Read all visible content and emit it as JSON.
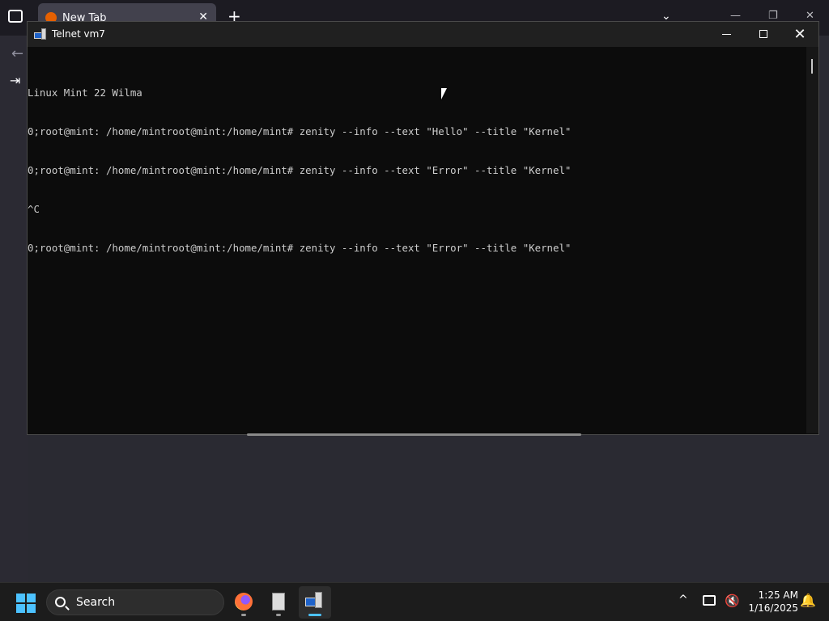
{
  "browser": {
    "tab_label": "New Tab",
    "tab_close_glyph": "✕",
    "new_tab_glyph": "+",
    "list_tabs_glyph": "⌄",
    "minimize_glyph": "—",
    "restore_glyph": "❐",
    "close_glyph": "✕",
    "back_glyph": "←",
    "signin_glyph": "⇥",
    "icons": [
      "tab-list-icon",
      "firefox-favicon",
      "back-arrow-icon",
      "sign-in-icon"
    ]
  },
  "telnet_window": {
    "title": "Telnet vm7",
    "close_glyph": "✕",
    "terminal_lines": [
      "Linux Mint 22 Wilma",
      "0;root@mint: /home/mintroot@mint:/home/mint# zenity --info --text \"Hello\" --title \"Kernel\"",
      "0;root@mint: /home/mintroot@mint:/home/mint# zenity --info --text \"Error\" --title \"Kernel\"",
      "^C",
      "0;root@mint: /home/mintroot@mint:/home/mint# zenity --info --text \"Error\" --title \"Kernel\""
    ]
  },
  "taskbar": {
    "search_label": "Search",
    "pinned_apps": [
      "firefox",
      "notepad",
      "telnet"
    ],
    "active_app": "telnet",
    "tray_chevron_glyph": "^",
    "volume_glyph": "🔇",
    "bell_glyph": "🔔",
    "time": "1:25 AM",
    "date": "1/16/2025"
  },
  "colors": {
    "terminal_bg": "#0c0c0c",
    "terminal_fg": "#cccccc",
    "taskbar_bg": "#1c1c1c",
    "accent": "#4cc2ff"
  }
}
